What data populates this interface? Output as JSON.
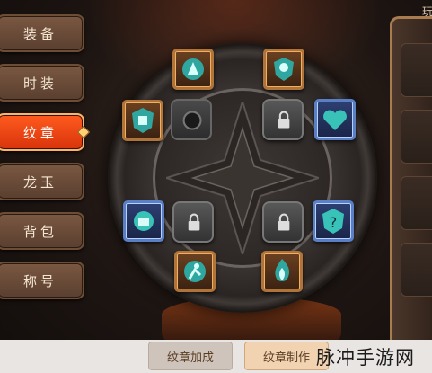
{
  "tabs": [
    {
      "label": "装备",
      "active": false
    },
    {
      "label": "时装",
      "active": false
    },
    {
      "label": "纹章",
      "active": true
    },
    {
      "label": "龙玉",
      "active": false
    },
    {
      "label": "背包",
      "active": false
    },
    {
      "label": "称号",
      "active": false
    }
  ],
  "side_panel": {
    "title": "玩"
  },
  "slots": [
    {
      "name": "emblem-slot-top-left",
      "kind": "bronze",
      "icon": "running-figure-icon"
    },
    {
      "name": "emblem-slot-top-right",
      "kind": "bronze",
      "icon": "shield-figure-icon"
    },
    {
      "name": "emblem-slot-left-upper",
      "kind": "bronze",
      "icon": "armor-icon"
    },
    {
      "name": "emblem-slot-empty",
      "kind": "empty",
      "icon": "empty-socket-icon"
    },
    {
      "name": "emblem-slot-locked-1",
      "kind": "locked",
      "icon": "lock-icon"
    },
    {
      "name": "emblem-slot-right-upper",
      "kind": "blue",
      "icon": "heart-icon"
    },
    {
      "name": "emblem-slot-left-lower",
      "kind": "blue",
      "icon": "fist-icon"
    },
    {
      "name": "emblem-slot-locked-2",
      "kind": "locked",
      "icon": "lock-icon"
    },
    {
      "name": "emblem-slot-locked-3",
      "kind": "locked",
      "icon": "lock-icon"
    },
    {
      "name": "emblem-slot-right-lower",
      "kind": "blue",
      "icon": "question-shield-icon"
    },
    {
      "name": "emblem-slot-bottom-left",
      "kind": "bronze",
      "icon": "sprint-figure-icon"
    },
    {
      "name": "emblem-slot-bottom-right",
      "kind": "bronze",
      "icon": "flame-icon"
    }
  ],
  "buttons": {
    "enhance": "纹章加成",
    "craft": "纹章制作"
  },
  "watermark": "脉冲手游网",
  "colors": {
    "active_tab": "#e8441a",
    "tab": "#6a4a36",
    "bronze_frame": "#b0733a",
    "blue_frame": "#5a7fc4"
  }
}
